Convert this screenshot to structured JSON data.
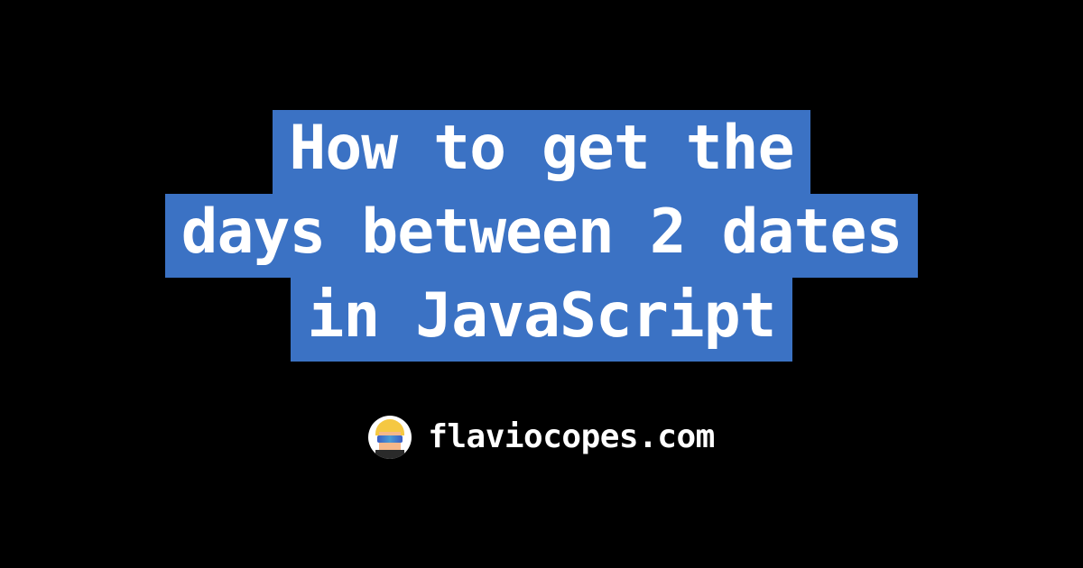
{
  "title": {
    "line1": "How to get the",
    "line2": "days between 2 dates",
    "line3": "in JavaScript"
  },
  "footer": {
    "site_name": "flaviocopes.com"
  }
}
